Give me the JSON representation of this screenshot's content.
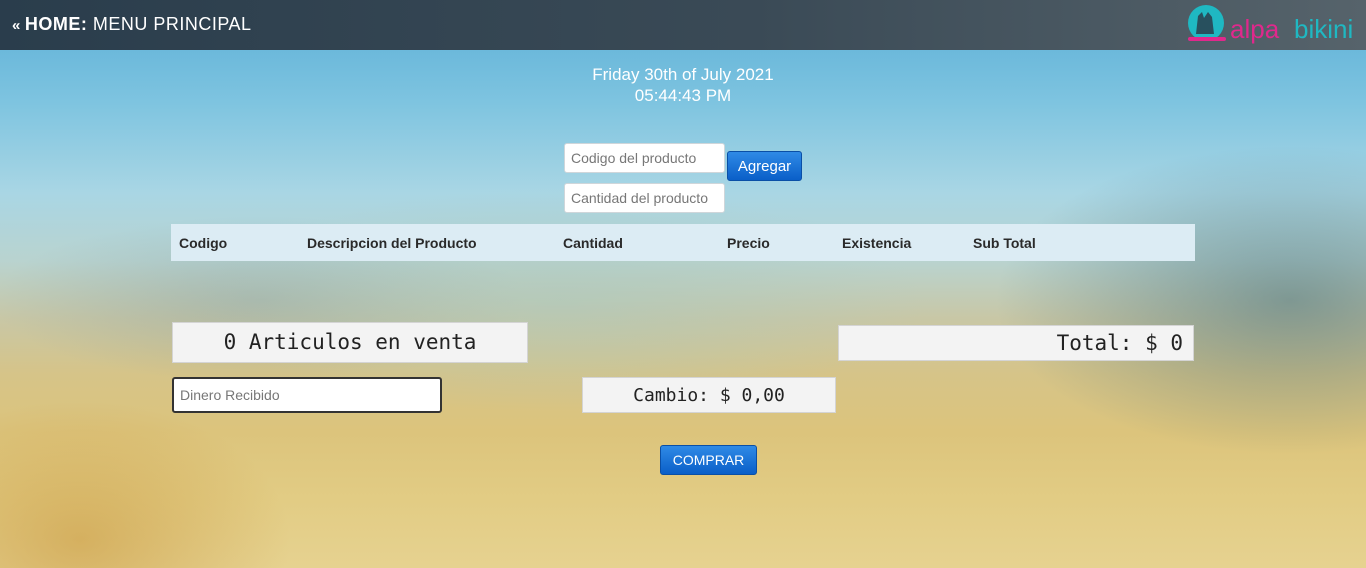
{
  "header": {
    "chevron": "«",
    "home_label": "HOME:",
    "title": "MENU PRINCIPAL",
    "logo": {
      "text_main": "alpa",
      "text_secondary": "bikini",
      "colors": {
        "teal": "#1fb8c2",
        "pink": "#e0288c"
      }
    }
  },
  "datetime": {
    "date": "Friday 30th of July 2021",
    "time": "05:44:43 PM"
  },
  "product_form": {
    "code_placeholder": "Codigo del producto",
    "quantity_placeholder": "Cantidad del producto",
    "add_button": "Agregar"
  },
  "table": {
    "columns": [
      "Codigo",
      "Descripcion del Producto",
      "Cantidad",
      "Precio",
      "Existencia",
      "Sub Total"
    ],
    "rows": []
  },
  "summary": {
    "articles": "0 Articulos en venta",
    "total": "Total: $ 0",
    "money_placeholder": "Dinero Recibido",
    "change": "Cambio: $ 0,00",
    "buy_button": "COMPRAR"
  },
  "colors": {
    "topbar": "#2a3d4c",
    "button": "#0a5fc8",
    "table_header": "#dcecf4",
    "panel": "#f3f3f3"
  }
}
